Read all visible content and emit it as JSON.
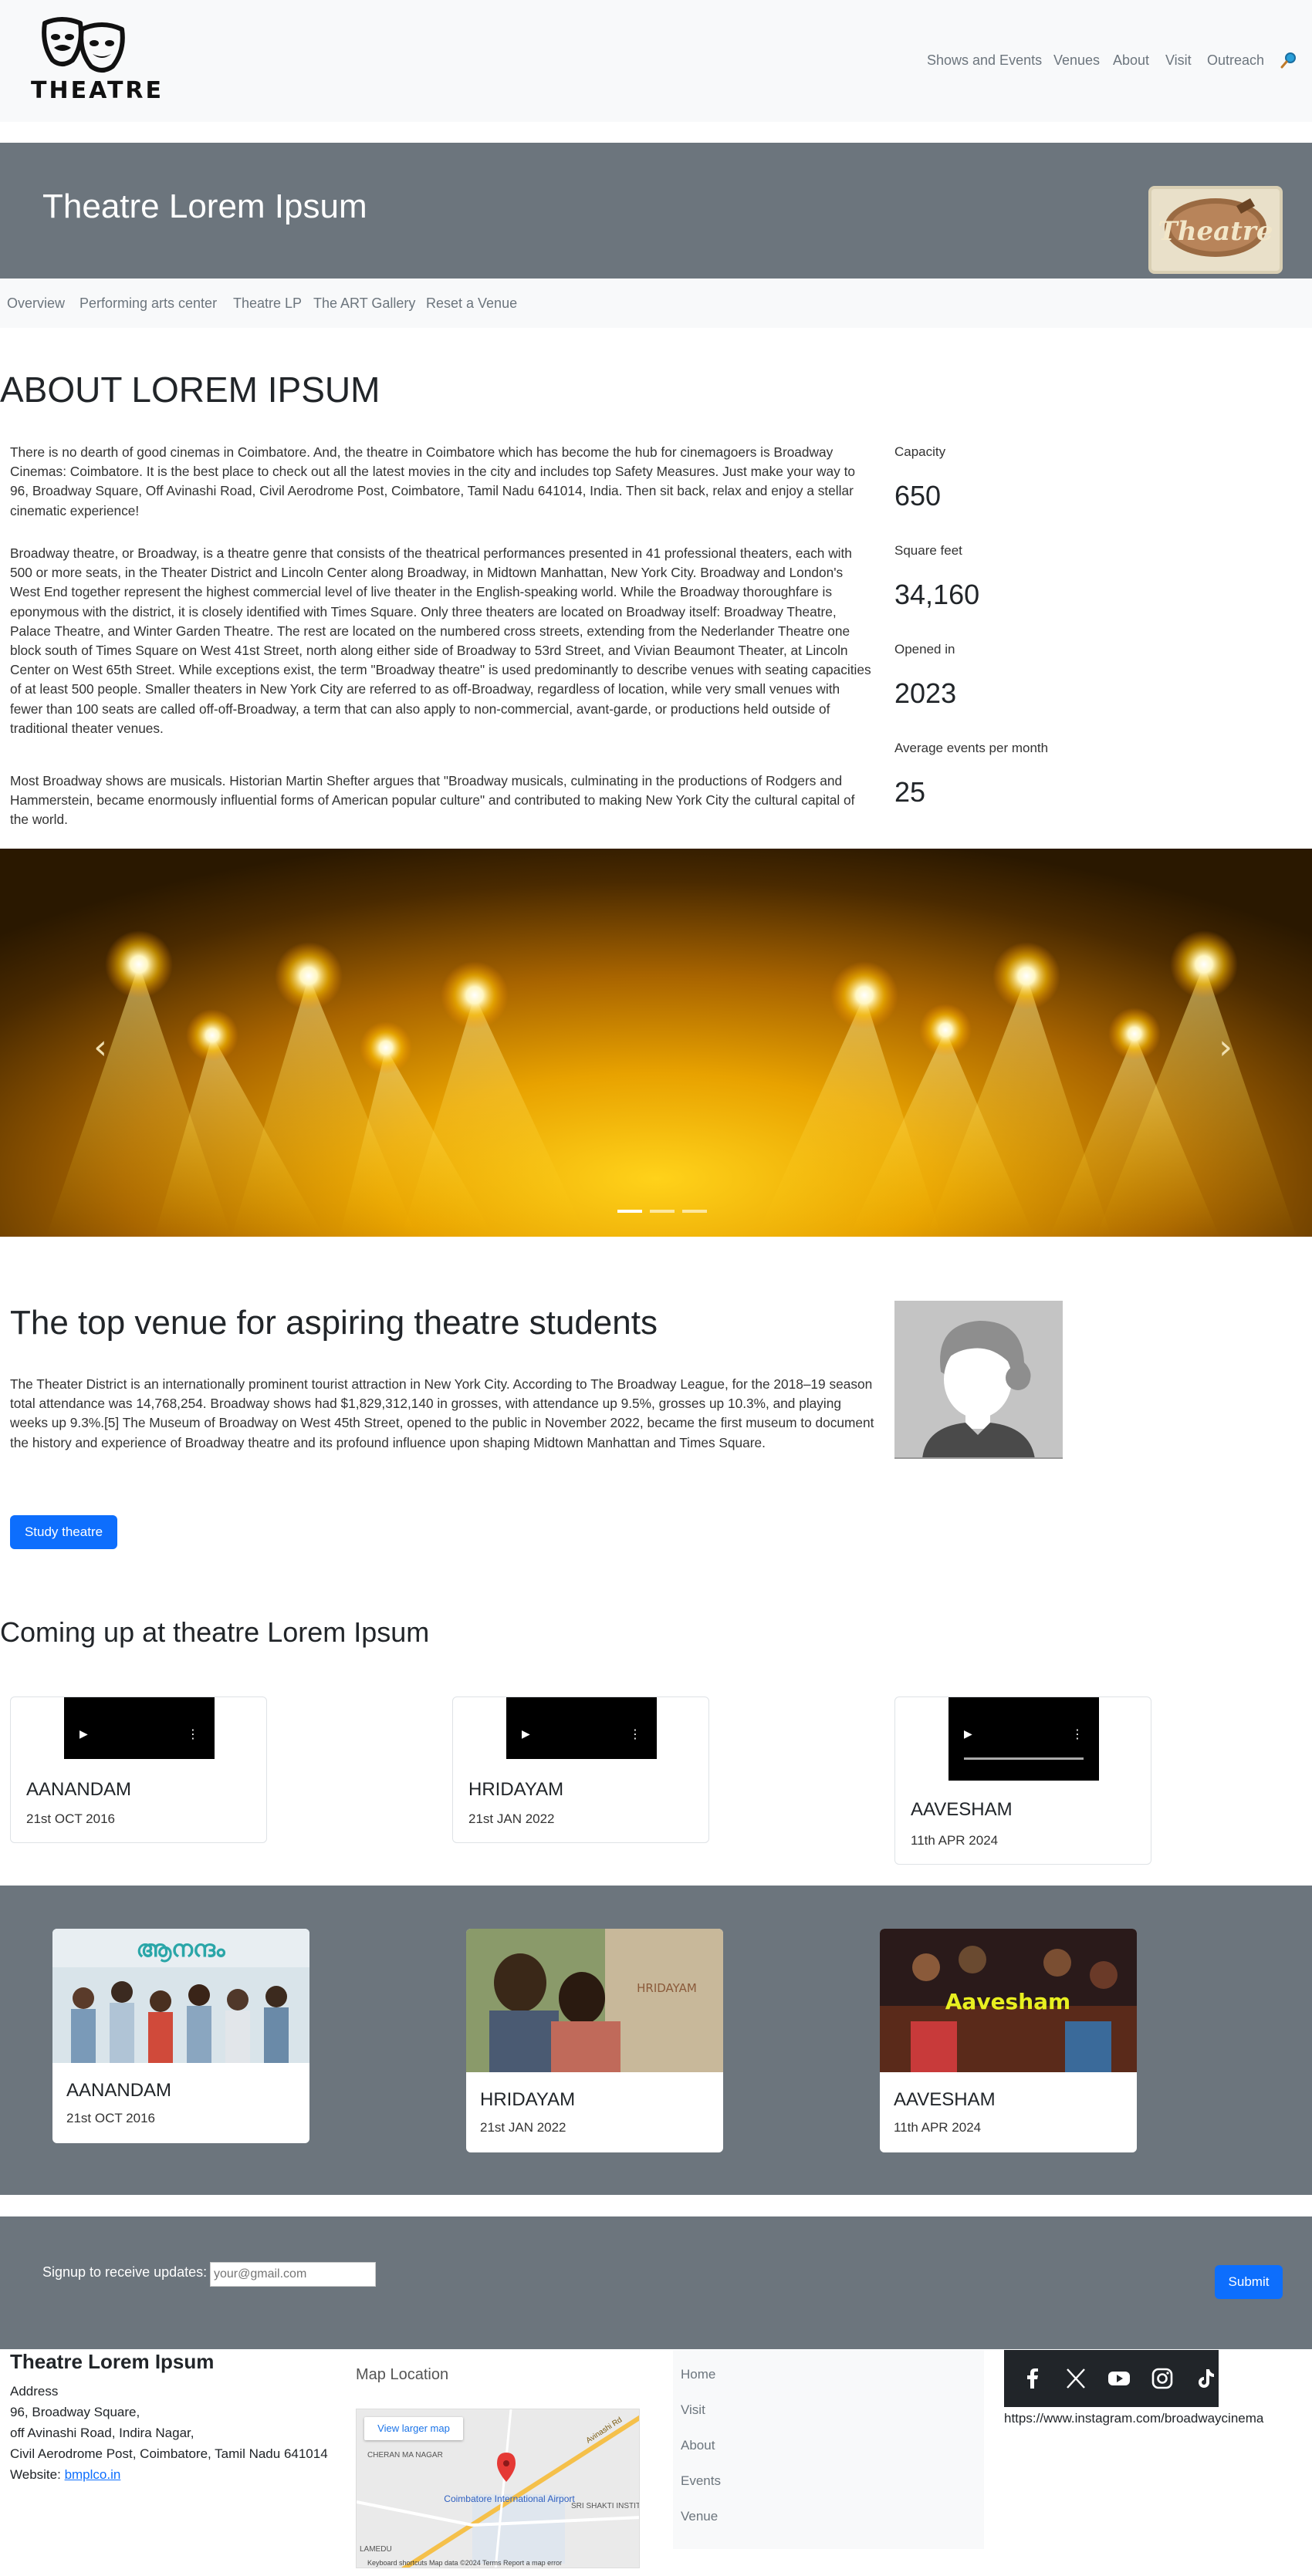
{
  "brand": {
    "logo_text": "THEATRE"
  },
  "nav": {
    "items": [
      "Shows and Events",
      "Venues",
      "About",
      "Visit",
      "Outreach"
    ]
  },
  "hero": {
    "title": "Theatre Lorem Ipsum",
    "badge_text": "Theatre"
  },
  "subnav": {
    "items": [
      "Overview",
      "Performing arts center",
      "Theatre LP",
      "The ART Gallery",
      "Reset a Venue"
    ]
  },
  "about": {
    "title": "ABOUT LOREM IPSUM",
    "paragraphs": [
      "There is no dearth of good cinemas in Coimbatore. And, the theatre in Coimbatore which has become the hub for cinemagoers is Broadway Cinemas: Coimbatore. It is the best place to check out all the latest movies in the city and includes top Safety Measures. Just make your way to 96, Broadway Square, Off Avinashi Road, Civil Aerodrome Post, Coimbatore, Tamil Nadu 641014, India. Then sit back, relax and enjoy a stellar cinematic experience!",
      "Broadway theatre, or Broadway, is a theatre genre that consists of the theatrical performances presented in 41 professional theaters, each with 500 or more seats, in the Theater District and Lincoln Center along Broadway, in Midtown Manhattan, New York City. Broadway and London's West End together represent the highest commercial level of live theater in the English-speaking world. While the Broadway thoroughfare is eponymous with the district, it is closely identified with Times Square. Only three theaters are located on Broadway itself: Broadway Theatre, Palace Theatre, and Winter Garden Theatre. The rest are located on the numbered cross streets, extending from the Nederlander Theatre one block south of Times Square on West 41st Street, north along either side of Broadway to 53rd Street, and Vivian Beaumont Theater, at Lincoln Center on West 65th Street. While exceptions exist, the term \"Broadway theatre\" is used predominantly to describe venues with seating capacities of at least 500 people. Smaller theaters in New York City are referred to as off-Broadway, regardless of location, while very small venues with fewer than 100 seats are called off-off-Broadway, a term that can also apply to non-commercial, avant-garde, or productions held outside of traditional theater venues.",
      "Most Broadway shows are musicals. Historian Martin Shefter argues that \"Broadway musicals, culminating in the productions of Rodgers and Hammerstein, became enormously influential forms of American popular culture\" and contributed to making New York City the cultural capital of the world."
    ],
    "stats": [
      {
        "label": "Capacity",
        "value": "650"
      },
      {
        "label": "Square feet",
        "value": "34,160"
      },
      {
        "label": "Opened in",
        "value": "2023"
      },
      {
        "label": "Average events per month",
        "value": "25"
      }
    ]
  },
  "carousel": {
    "prev_icon": "‹",
    "next_icon": "›",
    "slide_count": 3,
    "active_index": 0
  },
  "venue": {
    "title": "The top venue for aspiring theatre students",
    "text": "The Theater District is an internationally prominent tourist attraction in New York City. According to The Broadway League, for the 2018–19 season total attendance was 14,768,254. Broadway shows had $1,829,312,140 in grosses, with attendance up 9.5%, grosses up 10.3%, and playing weeks up 9.3%.[5] The Museum of Broadway on West 45th Street, opened to the public in November 2022, became the first museum to document the history and experience of Broadway theatre and its profound influence upon shaping Midtown Manhattan and Times Square.",
    "button": "Study theatre"
  },
  "coming_up": {
    "title": "Coming up at theatre Lorem Ipsum",
    "cards": [
      {
        "title": "AANANDAM",
        "date": "21st OCT 2016"
      },
      {
        "title": "HRIDAYAM",
        "date": "21st JAN 2022"
      },
      {
        "title": "AAVESHAM",
        "date": "11th APR 2024"
      }
    ]
  },
  "gallery": {
    "cards": [
      {
        "title": "AANANDAM",
        "date": "21st OCT 2016",
        "poster_text": "ആനന്ദം"
      },
      {
        "title": "HRIDAYAM",
        "date": "21st JAN 2022",
        "poster_text": "HRIDAYAM"
      },
      {
        "title": "AAVESHAM",
        "date": "11th APR 2024",
        "poster_text": "Aavesham"
      }
    ]
  },
  "signup": {
    "label": "Signup to receive updates:",
    "placeholder": "your@gmail.com",
    "button": "Submit"
  },
  "footer": {
    "name": "Theatre Lorem Ipsum",
    "address_lines": [
      "Address",
      "96, Broadway Square,",
      "off Avinashi Road, Indira Nagar,",
      "Civil Aerodrome Post, Coimbatore, Tamil Nadu 641014"
    ],
    "website_label": "Website:",
    "website_link": "bmplco.in",
    "map_title": "Map Location",
    "map_larger": "View larger map",
    "map_labels": {
      "airport": "Coimbatore International Airport",
      "area1": "CHERAN MA NAGAR",
      "area2": "SRI SHAKTI INSTITUTE O",
      "area3": "LAMEDU",
      "road": "Avinashi Rd",
      "footer": "Keyboard shortcuts   Map data ©2024   Terms   Report a map error"
    },
    "links": [
      "Home",
      "Visit",
      "About",
      "Events",
      "Venue"
    ],
    "instagram_url": "https://www.instagram.com/broadwaycinema"
  },
  "colors": {
    "primary": "#0d6efd",
    "band": "#6c757d",
    "light": "#f8f9fa"
  }
}
